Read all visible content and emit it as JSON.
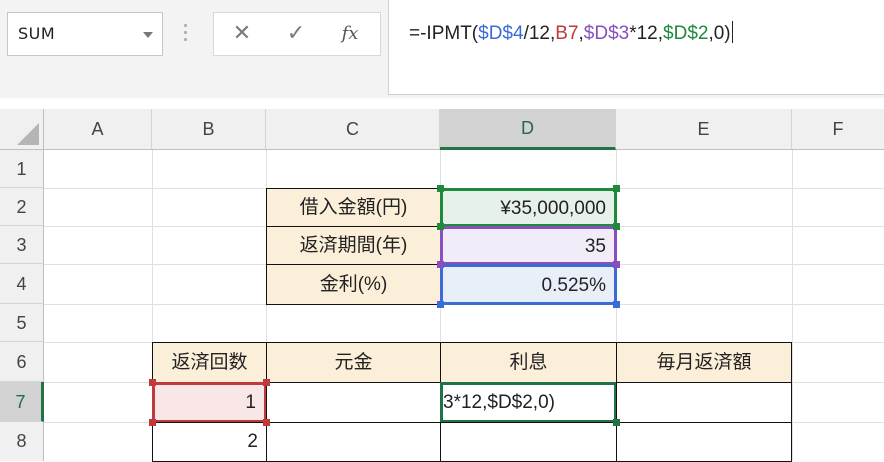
{
  "formula_bar": {
    "name_box": "SUM",
    "cancel_icon": "✕",
    "enter_icon": "✓",
    "function_icon": "fx",
    "formula_parts": [
      {
        "text": "=-IPMT(",
        "color": "#222222"
      },
      {
        "text": "$D$4",
        "color": "#3b6bd6"
      },
      {
        "text": "/12,",
        "color": "#222222"
      },
      {
        "text": "B7",
        "color": "#c0393b"
      },
      {
        "text": ",",
        "color": "#222222"
      },
      {
        "text": "$D$3",
        "color": "#8a4fbf"
      },
      {
        "text": "*12,",
        "color": "#222222"
      },
      {
        "text": "$D$2",
        "color": "#1f8a3c"
      },
      {
        "text": ",0)",
        "color": "#222222"
      }
    ]
  },
  "columns": [
    "A",
    "B",
    "C",
    "D",
    "E",
    "F"
  ],
  "rows": [
    "1",
    "2",
    "3",
    "4",
    "5",
    "6",
    "7",
    "8"
  ],
  "selected_column": "D",
  "selected_row": "7",
  "loan_table": {
    "amount_label": "借入金額(円)",
    "amount_value": "¥35,000,000",
    "period_label": "返済期間(年)",
    "period_value": "35",
    "rate_label": "金利(%)",
    "rate_value": "0.525%"
  },
  "schedule": {
    "headers": [
      "返済回数",
      "元金",
      "利息",
      "毎月返済額"
    ],
    "rows": [
      {
        "count": "1",
        "principal": "",
        "interest": "3*12,$D$2,0)",
        "monthly": ""
      },
      {
        "count": "2",
        "principal": "",
        "interest": "",
        "monthly": ""
      }
    ]
  },
  "reference_colors": {
    "D2": "#1f8a3c",
    "D3": "#8a4fbf",
    "D4": "#3b6bd6",
    "B7": "#c0393b",
    "active": "#217346"
  }
}
